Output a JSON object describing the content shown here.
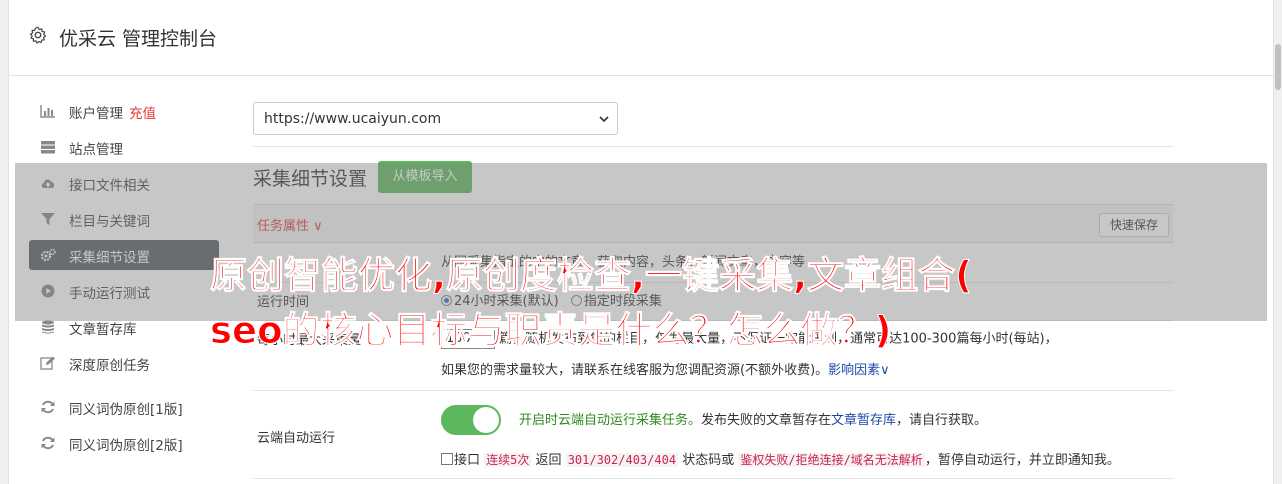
{
  "header": {
    "title": "优采云 管理控制台",
    "icon": "gear-icon"
  },
  "sidebar": {
    "items": [
      {
        "label": "账户管理",
        "extra": "充值",
        "icon": "bar-chart-icon"
      },
      {
        "label": "站点管理",
        "icon": "server-icon"
      },
      {
        "label": "接口文件相关",
        "icon": "cloud-upload-icon"
      },
      {
        "label": "栏目与关键词",
        "icon": "filter-icon"
      },
      {
        "label": "采集细节设置",
        "icon": "gears-icon",
        "active": true
      },
      {
        "label": "手动运行测试",
        "icon": "play-circle-icon"
      },
      {
        "label": "文章暂存库",
        "icon": "database-icon"
      },
      {
        "label": "深度原创任务",
        "icon": "edit-icon"
      },
      {
        "label": "同义词伪原创[1版]",
        "icon": "refresh-icon"
      },
      {
        "label": "同义词伪原创[2版]",
        "icon": "refresh-icon"
      }
    ]
  },
  "site_select": {
    "value": "https://www.ucaiyun.com"
  },
  "section": {
    "title": "采集细节设置",
    "template_button": "从模板导入"
  },
  "table": {
    "header": {
      "task_attr": "任务属性",
      "quick_save": "快速保存"
    },
    "row1": {
      "value": "从网采集指定的中的文章，获取内容，头条，新闻文章，内容等"
    },
    "row2": {
      "label": "运行时间",
      "opt1": "24小时采集(默认)",
      "opt2": "指定时段采集"
    },
    "row3": {
      "label": "每小时最大采集量",
      "input": "100",
      "line1": "篇，随机发布到您的栏目，仅为最大量，不保证一定能采到，通常可达100-300篇每小时(每站)，",
      "line2_prefix": "如果您的需求量较大，请联系在线客服为您调配资源(不额外收费)。",
      "line2_link": "影响因素"
    },
    "row4": {
      "label": "云端自动运行",
      "toggle_text": "开启时云端自动运行采集任务。",
      "desc_prefix": "发布失败的文章暂存在",
      "desc_link": "文章暂存库",
      "desc_suffix": "，请自行获取。",
      "chk_prefix": "接口",
      "code1": "连续5次",
      "mid1": "返回",
      "code2": "301/302/403/404",
      "mid2": "状态码或",
      "code3": "鉴权失败/拒绝连接/域名无法解析",
      "chk_suffix": "，暂停自动运行，并立即通知我。"
    }
  },
  "overlay": {
    "line1": "原创智能优化,原创度检查,一键采集,文章组合(",
    "line2": "seo的核心目标与职责是什么？怎么做？)"
  },
  "colors": {
    "accent_green": "#5cb85c",
    "link_blue": "#1c49a8",
    "red": "#e4393c",
    "active_nav": "#555b61"
  }
}
